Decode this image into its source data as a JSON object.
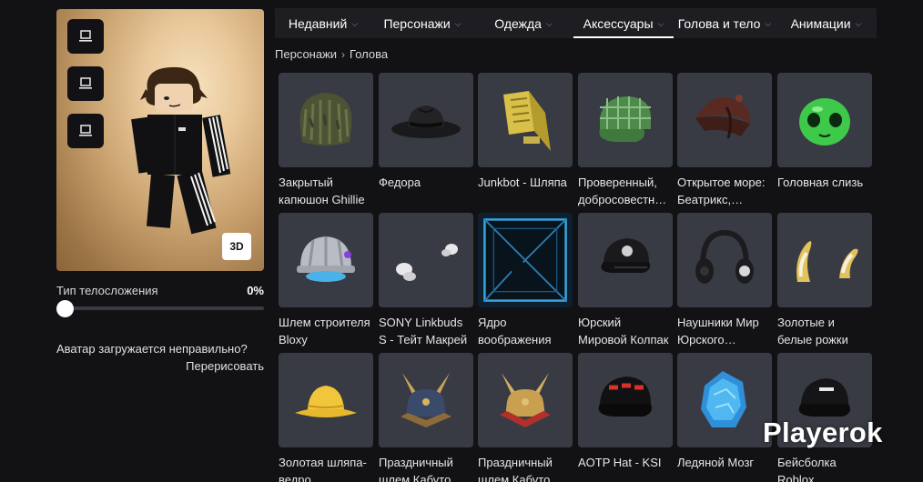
{
  "tabs": [
    {
      "label": "Недавний"
    },
    {
      "label": "Персонажи"
    },
    {
      "label": "Одежда"
    },
    {
      "label": "Аксессуары"
    },
    {
      "label": "Голова и тело"
    },
    {
      "label": "Анимации"
    }
  ],
  "breadcrumb": {
    "root": "Персонажи",
    "current": "Голова"
  },
  "avatar": {
    "btn_3d": "3D"
  },
  "body_type": {
    "label": "Тип телосложения",
    "value": "0%",
    "slider_fraction": 0
  },
  "avatar_problem": {
    "question": "Аватар загружается неправильно?",
    "link": "Перерисовать"
  },
  "items": [
    {
      "name": "Закрытый капюшон Ghillie",
      "icon": "ghillie-hood-icon"
    },
    {
      "name": "Федора",
      "icon": "fedora-icon"
    },
    {
      "name": "Junkbot - Шляпа",
      "icon": "junkbot-hat-icon"
    },
    {
      "name": "Проверенный, добросовестный колпак",
      "icon": "plaid-cap-icon"
    },
    {
      "name": "Открытое море: Беатрикс, пиратская шляпа",
      "icon": "pirate-hat-icon"
    },
    {
      "name": "Головная слизь",
      "icon": "slime-head-icon"
    },
    {
      "name": "Шлем строителя Bloxy",
      "icon": "builder-helmet-icon"
    },
    {
      "name": "SONY Linkbuds S - Тейт Макрей",
      "icon": "earbuds-icon"
    },
    {
      "name": "Ядро воображения",
      "icon": "imagination-core-icon"
    },
    {
      "name": "Юрский Мировой Колпак",
      "icon": "jurassic-cap-icon"
    },
    {
      "name": "Наушники Мир Юрского периода",
      "icon": "headphones-icon"
    },
    {
      "name": "Золотые и белые рожки",
      "icon": "gold-horns-icon"
    },
    {
      "name": "Золотая шляпа-ведро",
      "icon": "gold-bucket-hat-icon"
    },
    {
      "name": "Праздничный шлем Кабуто",
      "icon": "kabuto-helmet-icon"
    },
    {
      "name": "Праздничный шлем Кабуто",
      "icon": "kabuto-helmet-red-icon"
    },
    {
      "name": "AOTP Hat - KSI",
      "icon": "aotp-cap-icon"
    },
    {
      "name": "Ледяной Мозг",
      "icon": "ice-brain-icon"
    },
    {
      "name": "Бейсболка Roblox",
      "icon": "roblox-cap-icon"
    }
  ],
  "watermark": "Playerok",
  "colors": {
    "background": "#121215",
    "card": "#393b44",
    "tabbar": "#1d1d22",
    "accent": "#ffffff"
  }
}
